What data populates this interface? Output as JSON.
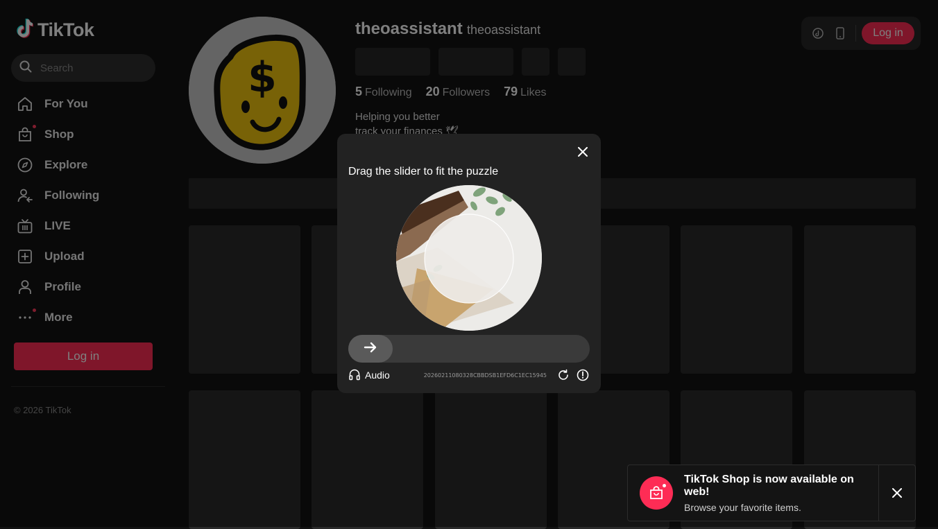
{
  "brand": {
    "name": "TikTok",
    "accent": "#fe2c55"
  },
  "search": {
    "placeholder": "Search"
  },
  "sidebar": {
    "items": [
      {
        "label": "For You",
        "icon": "home-icon"
      },
      {
        "label": "Shop",
        "icon": "shopping-bag-icon"
      },
      {
        "label": "Explore",
        "icon": "compass-icon"
      },
      {
        "label": "Following",
        "icon": "following-icon"
      },
      {
        "label": "LIVE",
        "icon": "live-tv-icon"
      },
      {
        "label": "Upload",
        "icon": "upload-icon"
      },
      {
        "label": "Profile",
        "icon": "profile-icon"
      },
      {
        "label": "More",
        "icon": "more-icon"
      }
    ],
    "login_label": "Log in",
    "copyright": "© 2026 TikTok"
  },
  "header": {
    "login_label": "Log in"
  },
  "profile": {
    "username": "theoassistant",
    "nickname": "theoassistant",
    "following_count": "5",
    "following_label": "Following",
    "followers_count": "20",
    "followers_label": "Followers",
    "likes_count": "79",
    "likes_label": "Likes",
    "bio_line1": "Helping you better",
    "bio_line2": "track your finances 🕊"
  },
  "captcha": {
    "title": "Drag the slider to fit the puzzle",
    "audio_label": "Audio",
    "id": "20260211080328CBBDSB1EFD6C1EC15945"
  },
  "toast": {
    "title": "TikTok Shop is now available on web!",
    "subtitle": "Browse your favorite items."
  }
}
